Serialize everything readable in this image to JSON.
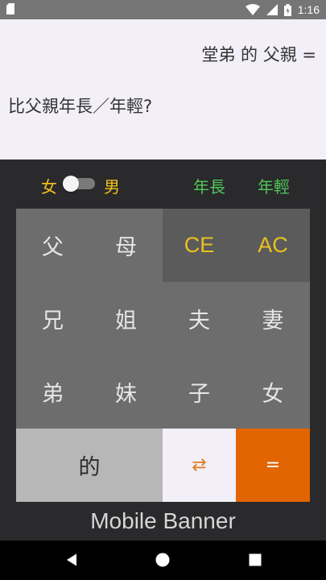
{
  "status_bar": {
    "time": "1:16",
    "icons": [
      "sd-card-icon",
      "wifi-icon",
      "signal-icon",
      "battery-charging-icon"
    ]
  },
  "display": {
    "expression": "堂弟 的 父親 =",
    "question": "比父親年長／年輕?"
  },
  "options": {
    "female_label": "女",
    "male_label": "男",
    "gender_toggle": "off",
    "elder_label": "年長",
    "younger_label": "年輕"
  },
  "keypad": {
    "father": "父",
    "mother": "母",
    "clear_entry": "CE",
    "all_clear": "AC",
    "elder_brother": "兄",
    "elder_sister": "姐",
    "husband": "夫",
    "wife": "妻",
    "younger_brother": "弟",
    "younger_sister": "妹",
    "son": "子",
    "daughter": "女",
    "of": "的",
    "swap": "⇄",
    "equals": "="
  },
  "banner": {
    "text": "Mobile Banner"
  },
  "colors": {
    "accent_yellow": "#f2c31b",
    "accent_green": "#4fc857",
    "equals_orange": "#e16500"
  }
}
